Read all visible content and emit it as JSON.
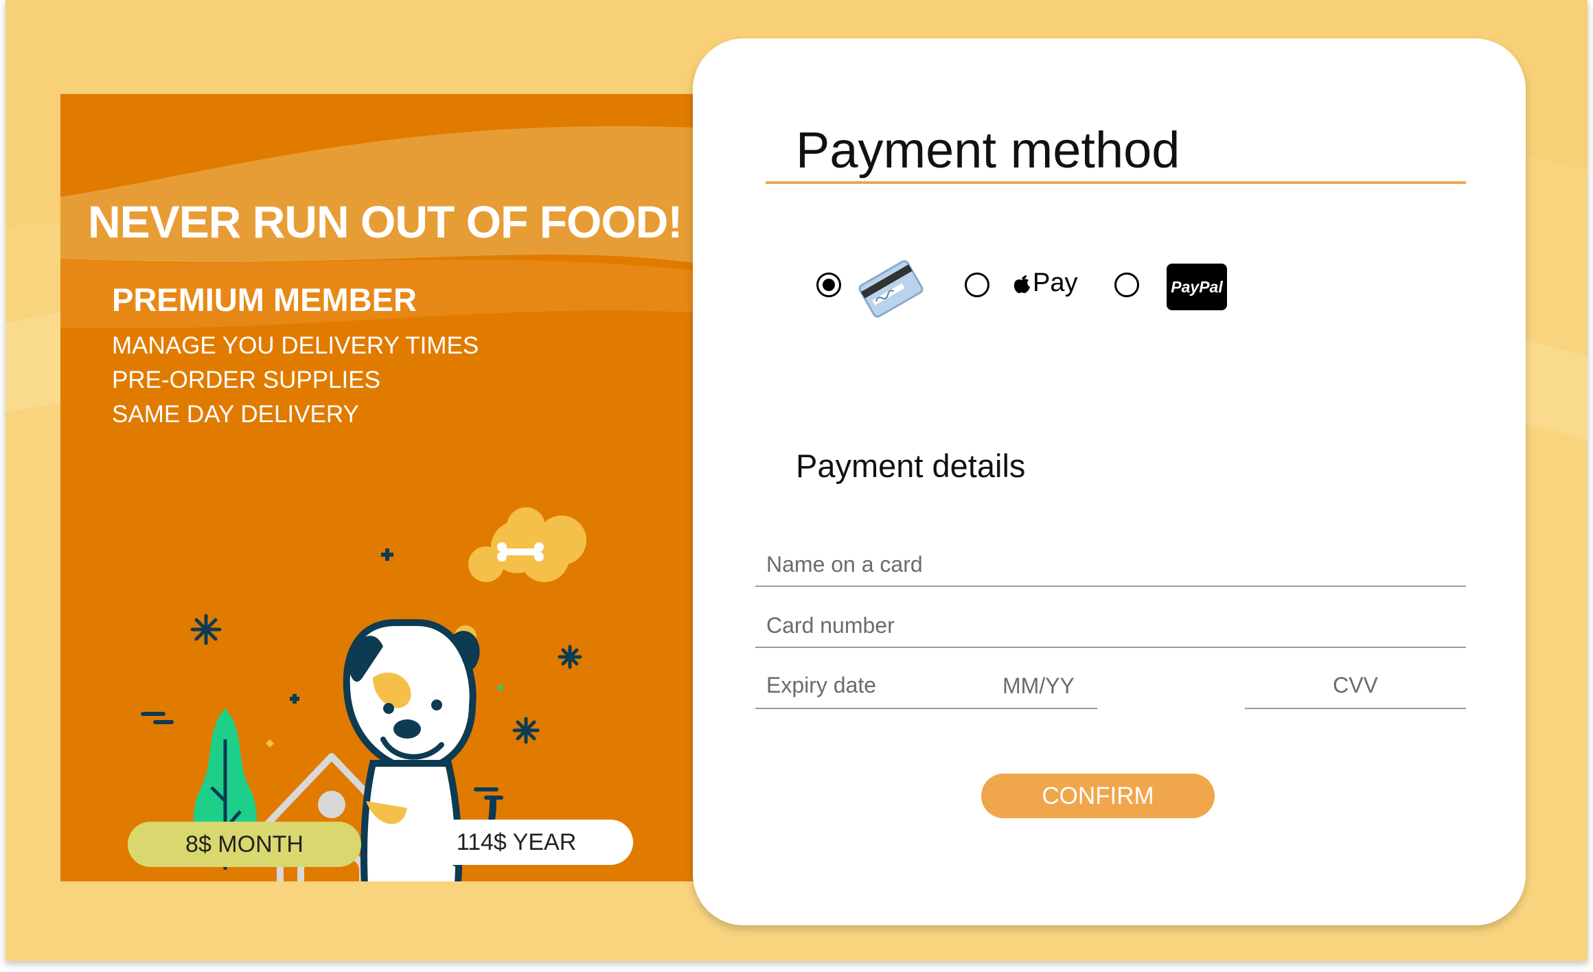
{
  "promo": {
    "headline": "NEVER RUN OUT OF FOOD!",
    "plan_title": "PREMIUM MEMBER",
    "features": [
      "MANAGE YOU DELIVERY TIMES",
      "PRE-ORDER  SUPPLIES",
      "SAME DAY DELIVERY"
    ],
    "price_month": "8$ MONTH",
    "price_year": "114$ YEAR"
  },
  "payment": {
    "title": "Payment method",
    "methods": [
      {
        "id": "card",
        "icon": "credit-card-icon",
        "selected": true
      },
      {
        "id": "apple-pay",
        "label": "Pay",
        "icon": "apple-icon",
        "selected": false
      },
      {
        "id": "paypal",
        "label": "PayPal",
        "selected": false
      }
    ],
    "details_title": "Payment details",
    "name_placeholder": "Name on a card",
    "number_placeholder": "Card number",
    "expiry_placeholder": "Expiry date",
    "expiry_hint": "MM/YY",
    "cvv_placeholder": "CVV",
    "confirm_label": "CONFIRM"
  },
  "colors": {
    "background": "#f8d47e",
    "promo_orange": "#e07b00",
    "accent": "#f0a64a",
    "month_pill": "#d9d86e",
    "dog_outline": "#0d3b52",
    "tree_green": "#1ecf8a"
  }
}
